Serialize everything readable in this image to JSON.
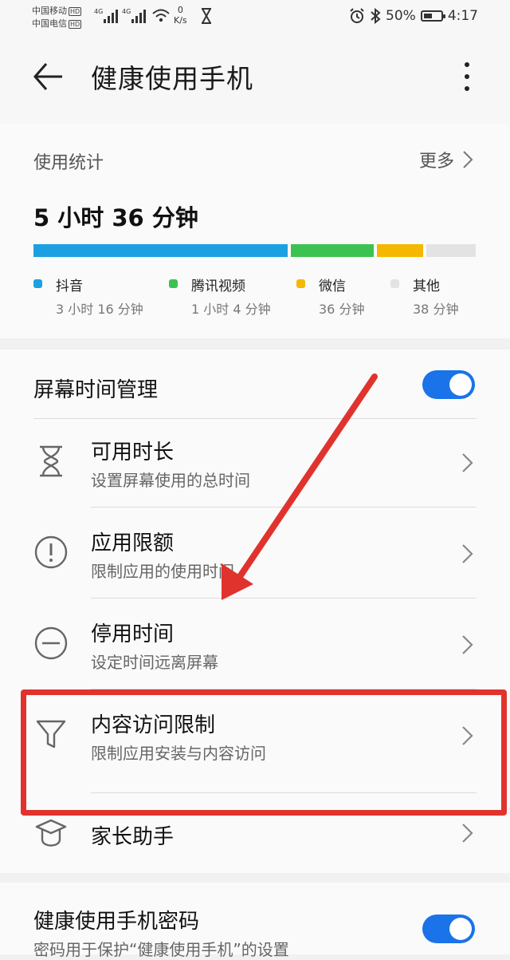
{
  "status_bar": {
    "carrier_1": "中国移动",
    "carrier_2": "中国电信",
    "hd_badge": "HD",
    "net_type_1": "4G",
    "net_type_2": "4G",
    "speed_value": "0",
    "speed_unit": "K/s",
    "battery_percent": "50%",
    "battery_level": 0.5,
    "time": "4:17"
  },
  "header": {
    "title": "健康使用手机"
  },
  "usage": {
    "label": "使用统计",
    "more_label": "更多",
    "total": "5 小时 36 分钟",
    "apps": [
      {
        "name": "抖音",
        "duration": "3 小时 16 分钟",
        "minutes": 196,
        "color": "#1ba1e2"
      },
      {
        "name": "腾讯视频",
        "duration": "1 小时 4 分钟",
        "minutes": 64,
        "color": "#3cc251"
      },
      {
        "name": "微信",
        "duration": "36 分钟",
        "minutes": 36,
        "color": "#f5b800"
      },
      {
        "name": "其他",
        "duration": "38 分钟",
        "minutes": 38,
        "color": "#e3e3e3"
      }
    ]
  },
  "screen_time": {
    "title": "屏幕时间管理",
    "enabled": true,
    "items": [
      {
        "title": "可用时长",
        "subtitle": "设置屏幕使用的总时间",
        "icon": "hourglass-icon"
      },
      {
        "title": "应用限额",
        "subtitle": "限制应用的使用时间",
        "icon": "exclamation-circle-icon"
      },
      {
        "title": "停用时间",
        "subtitle": "设定时间远离屏幕",
        "icon": "minus-circle-icon"
      },
      {
        "title": "内容访问限制",
        "subtitle": "限制应用安装与内容访问",
        "icon": "funnel-icon"
      },
      {
        "title": "家长助手",
        "subtitle": "",
        "icon": "graduation-cap-icon"
      }
    ]
  },
  "password": {
    "title": "健康使用手机密码",
    "description": "密码用于保护“健康使用手机”的设置",
    "enabled": true
  },
  "colors": {
    "accent": "#1a73e8",
    "annotation": "#e0332d"
  }
}
